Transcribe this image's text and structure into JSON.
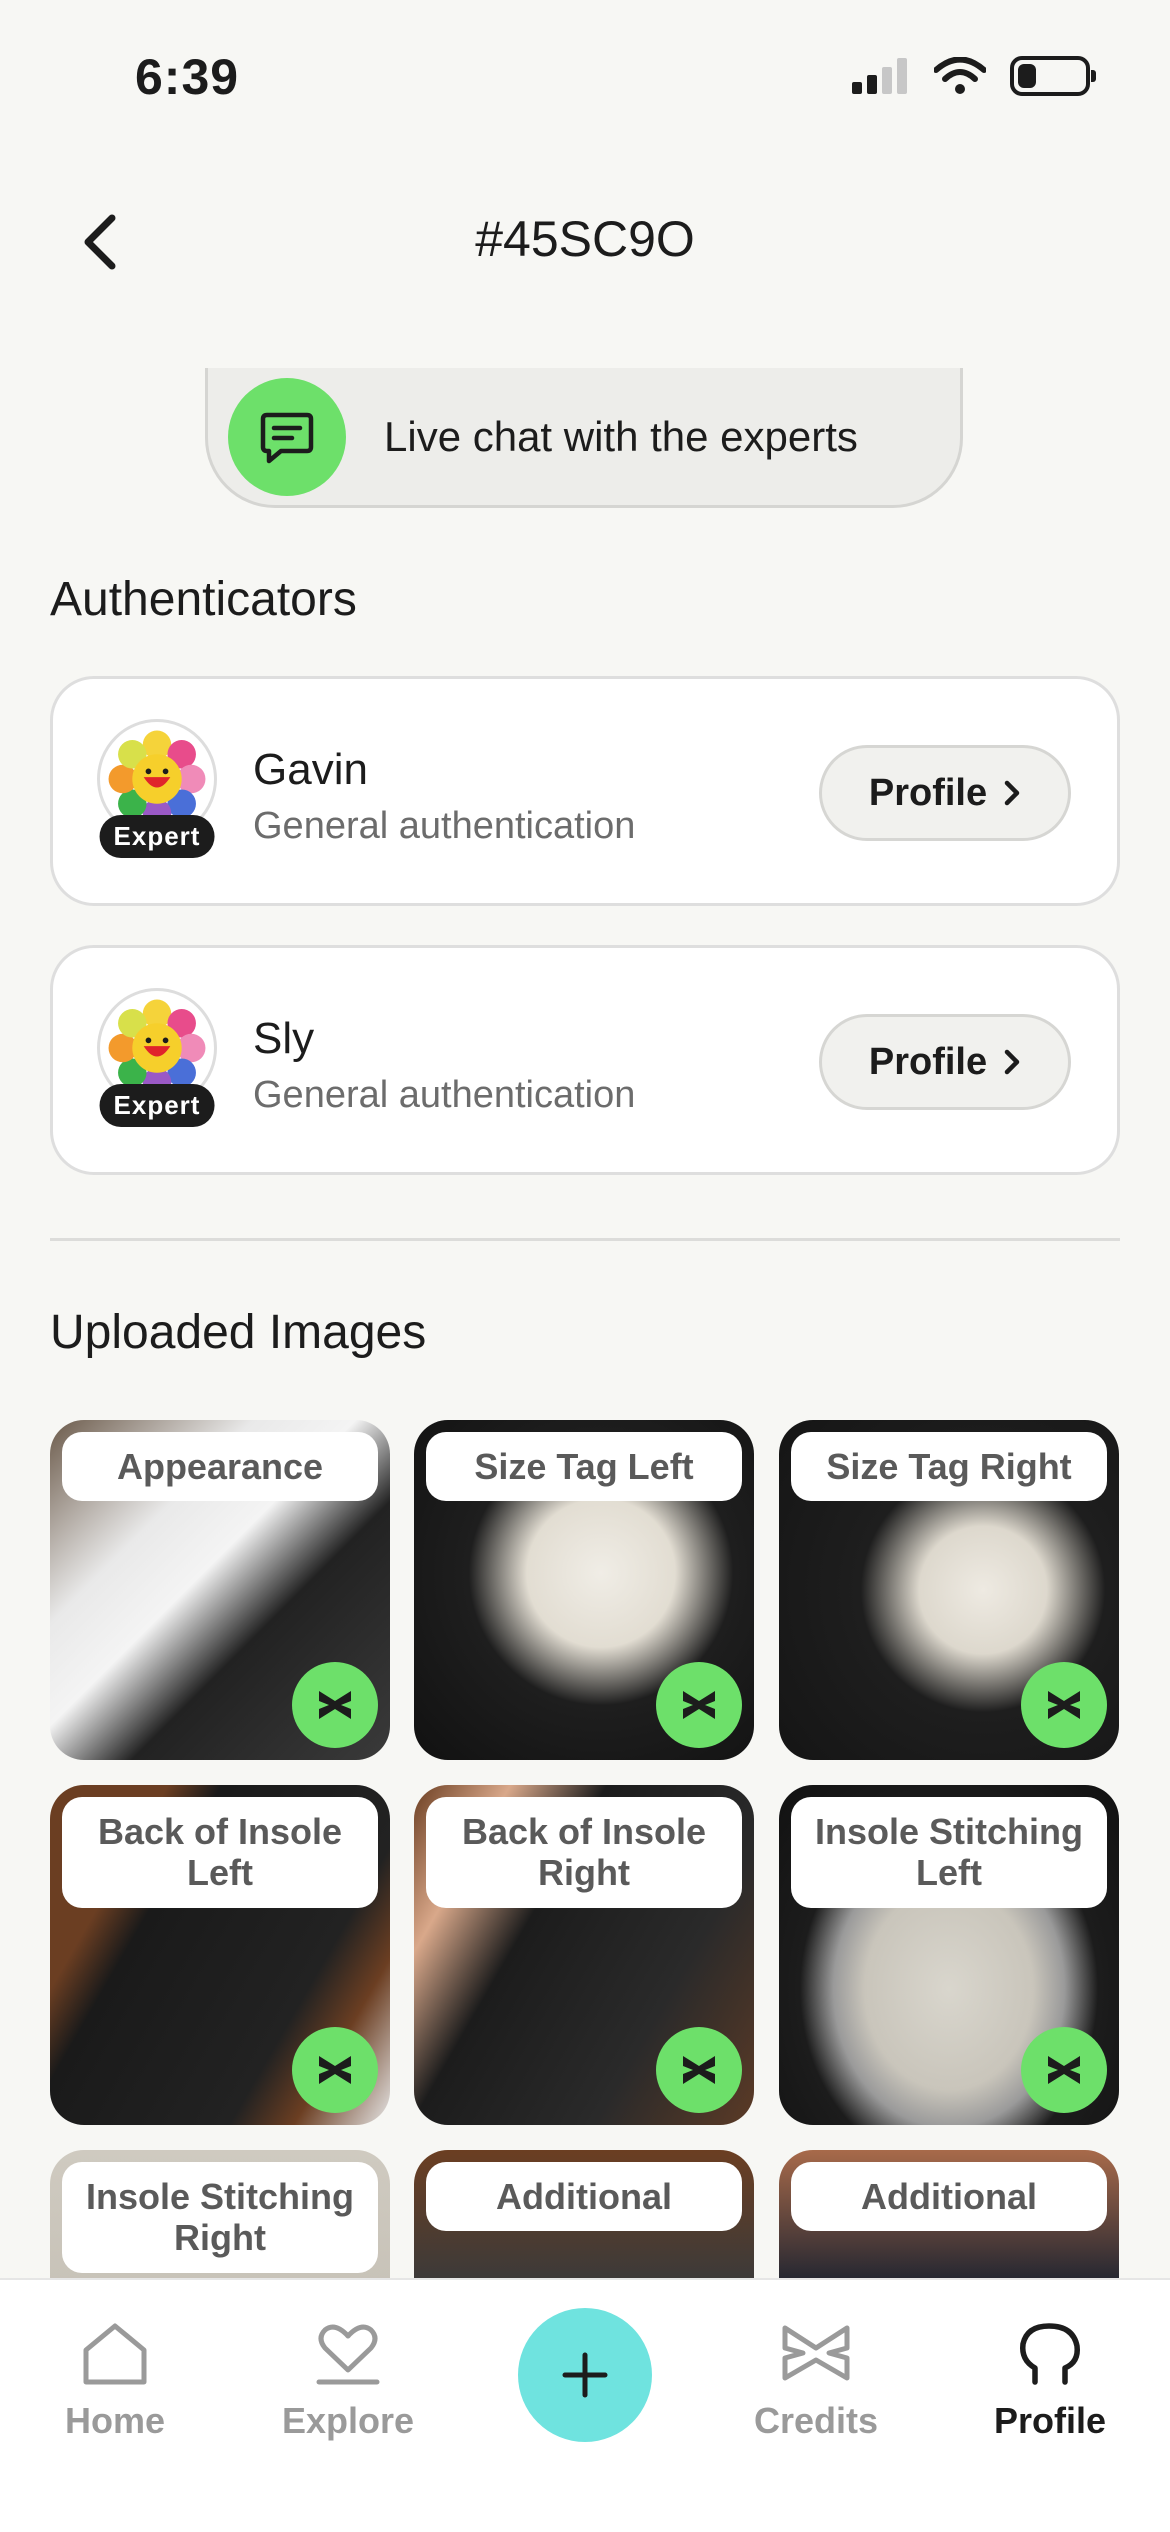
{
  "status": {
    "time": "6:39"
  },
  "header": {
    "title": "#45SC9O"
  },
  "chat": {
    "label": "Live chat with the experts"
  },
  "authenticators": {
    "title": "Authenticators",
    "items": [
      {
        "name": "Gavin",
        "role": "General authentication",
        "badge": "Expert",
        "button": "Profile"
      },
      {
        "name": "Sly",
        "role": "General authentication",
        "badge": "Expert",
        "button": "Profile"
      }
    ]
  },
  "uploads": {
    "title": "Uploaded Images",
    "tiles": [
      {
        "label": "Appearance"
      },
      {
        "label": "Size Tag Left"
      },
      {
        "label": "Size Tag Right"
      },
      {
        "label": "Back of Insole Left"
      },
      {
        "label": "Back of Insole Right"
      },
      {
        "label": "Insole Stitching Left"
      },
      {
        "label": "Insole Stitching Right"
      },
      {
        "label": "Additional"
      },
      {
        "label": "Additional"
      }
    ]
  },
  "tabbar": {
    "items": [
      {
        "label": "Home",
        "icon": "home-icon"
      },
      {
        "label": "Explore",
        "icon": "heart-icon"
      },
      {
        "label": "",
        "icon": "plus-icon"
      },
      {
        "label": "Credits",
        "icon": "credits-icon"
      },
      {
        "label": "Profile",
        "icon": "profile-icon"
      }
    ]
  },
  "colors": {
    "accent_green": "#6de06a",
    "accent_cyan": "#6fe3df",
    "background": "#f7f7f4"
  }
}
